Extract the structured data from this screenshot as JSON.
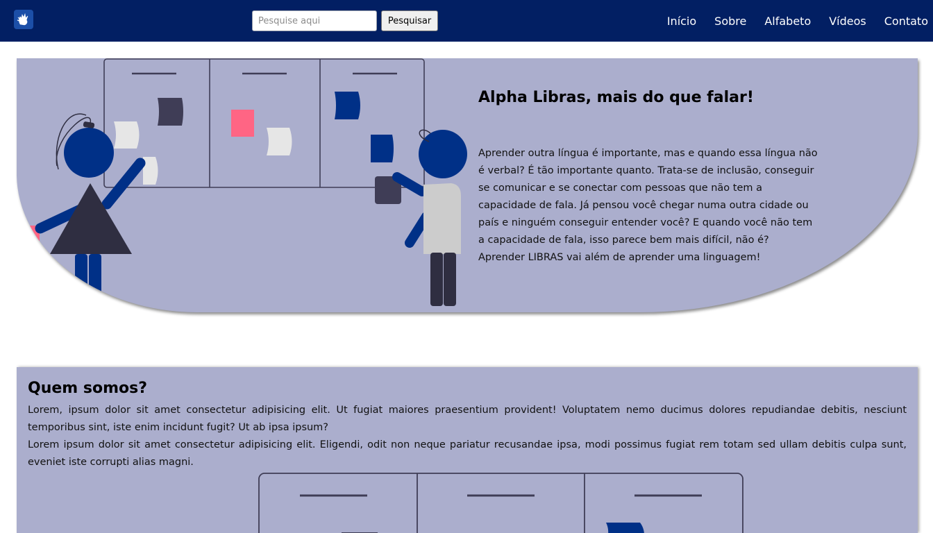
{
  "navbar": {
    "logo_icon": "sign-language-hand-icon",
    "search": {
      "placeholder": "Pesquise aqui",
      "value": ""
    },
    "search_button_label": "Pesquisar",
    "links": [
      "Início",
      "Sobre",
      "Alfabeto",
      "Vídeos",
      "Contato"
    ]
  },
  "hero": {
    "title": "Alpha Libras, mais do que falar!",
    "text": "Aprender outra língua é importante, mas e quando essa língua não é verbal? É tão importante quanto. Trata-se de inclusão, conseguir se comunicar e se conectar com pessoas que não tem a capacidade de fala. Já pensou você chegar numa outra cidade ou país e ninguém conseguir entender você? E quando você não tem a capacidade de fala, isso parece bem mais difícil, não é? Aprender LIBRAS vai além de aprender uma linguagem!",
    "illustration": "two-people-at-kanban-board-illustration"
  },
  "about": {
    "title": "Quem somos?",
    "paragraph1": "Lorem, ipsum dolor sit amet consectetur adipisicing elit. Ut fugiat maiores praesentium provident! Voluptatem nemo ducimus dolores repudiandae debitis, nesciunt temporibus sint, iste enim incidunt fugit? Ut ab ipsa ipsum?",
    "paragraph2": "Lorem ipsum dolor sit amet consectetur adipisicing elit. Eligendi, odit non neque pariatur recusandae ipsa, modi possimus fugiat rem totam sed ullam debitis culpa sunt, eveniet iste corrupti alias magni.",
    "illustration": "kanban-board-illustration"
  },
  "colors": {
    "navbar_bg": "#021f63",
    "section_bg": "#abaecd",
    "accent_blue": "#003087",
    "dark_gray": "#3f3d56",
    "pink_note": "#ff6584"
  }
}
